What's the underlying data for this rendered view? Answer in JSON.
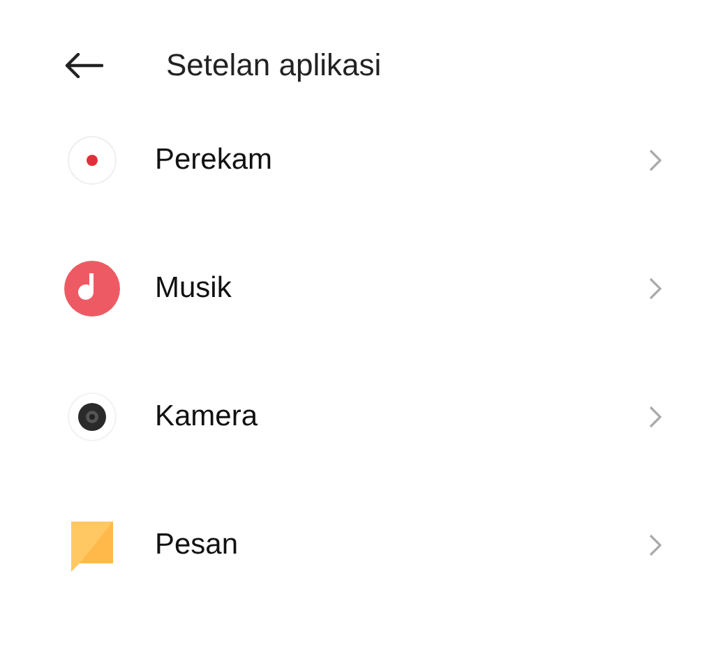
{
  "header": {
    "title": "Setelan aplikasi"
  },
  "apps": [
    {
      "kind": "recorder",
      "label": "Perekam"
    },
    {
      "kind": "music",
      "label": "Musik"
    },
    {
      "kind": "camera",
      "label": "Kamera"
    },
    {
      "kind": "messages",
      "label": "Pesan"
    }
  ]
}
